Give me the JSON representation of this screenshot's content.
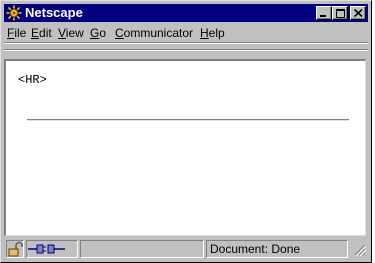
{
  "window": {
    "title": "Netscape",
    "controls": {
      "minimize": "minimize-icon",
      "maximize": "maximize-icon",
      "close": "close-icon"
    }
  },
  "menubar": {
    "items": [
      {
        "label": "File",
        "accel": "F",
        "rest": "ile"
      },
      {
        "label": "Edit",
        "accel": "E",
        "rest": "dit"
      },
      {
        "label": "View",
        "accel": "V",
        "rest": "iew"
      },
      {
        "label": "Go",
        "accel": "G",
        "rest": "o"
      },
      {
        "label": "Communicator",
        "accel": "C",
        "rest": "ommunicator"
      },
      {
        "label": "Help",
        "accel": "H",
        "rest": "elp"
      }
    ]
  },
  "page": {
    "text": "<HR>",
    "has_horizontal_rule": true
  },
  "statusbar": {
    "security_icon": "unlocked-padlock-icon",
    "connection_icon": "connection-plug-icon",
    "status_text": "Document: Done"
  },
  "colors": {
    "titlebar": "#000080",
    "chrome": "#c0c0c0",
    "content_bg": "#ffffff"
  }
}
